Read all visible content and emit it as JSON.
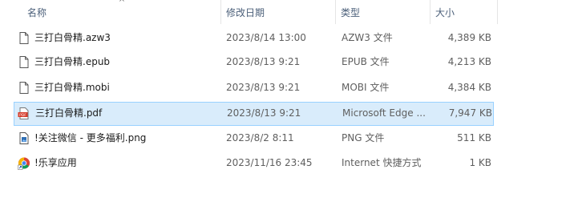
{
  "header": {
    "name_label": "名称",
    "date_label": "修改日期",
    "type_label": "类型",
    "size_label": "大小",
    "sort_indicator": "^"
  },
  "files": [
    {
      "name": "三打白骨精.azw3",
      "date": "2023/8/14 13:00",
      "type": "AZW3 文件",
      "size": "4,389 KB",
      "icon": "document-icon"
    },
    {
      "name": "三打白骨精.epub",
      "date": "2023/8/13 9:21",
      "type": "EPUB 文件",
      "size": "4,213 KB",
      "icon": "document-icon"
    },
    {
      "name": "三打白骨精.mobi",
      "date": "2023/8/13 9:21",
      "type": "MOBI 文件",
      "size": "4,384 KB",
      "icon": "document-icon"
    },
    {
      "name": "三打白骨精.pdf",
      "date": "2023/8/13 9:21",
      "type": "Microsoft Edge ...",
      "size": "7,947 KB",
      "icon": "pdf-icon",
      "selected": true
    },
    {
      "name": "!关注微信 - 更多福利.png",
      "date": "2023/8/2 8:11",
      "type": "PNG 文件",
      "size": "511 KB",
      "icon": "image-file-icon"
    },
    {
      "name": "!乐享应用",
      "date": "2023/11/16 23:45",
      "type": "Internet 快捷方式",
      "size": "1 KB",
      "icon": "chrome-shortcut-icon"
    }
  ],
  "colors": {
    "selected_background": "#d9ecfb",
    "selected_border": "#99d1ff",
    "header_text": "#4c607a",
    "pdf_red": "#d63b2a"
  }
}
